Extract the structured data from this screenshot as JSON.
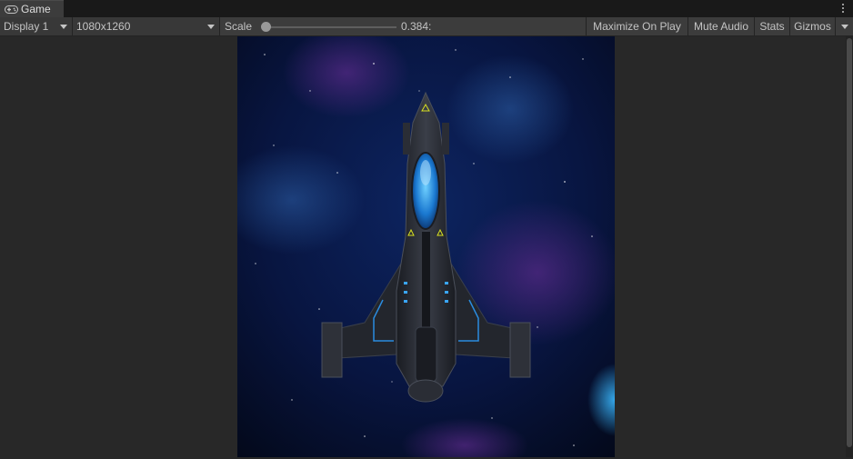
{
  "window": {
    "tab_label": "Game",
    "tab_icon": "gamepad-icon"
  },
  "toolbar": {
    "display_label": "Display 1",
    "resolution_label": "1080x1260",
    "scale_label": "Scale",
    "scale_value": "0.384:",
    "scale_slider_fraction": 0.0,
    "maximize_label": "Maximize On Play",
    "mute_label": "Mute Audio",
    "stats_label": "Stats",
    "gizmos_label": "Gizmos"
  },
  "game": {
    "scene_description_icon": "spaceship-icon",
    "background_colors": [
      "#050a1e",
      "#0b1a4a",
      "#3a1a5c",
      "#1a6aaa"
    ]
  }
}
